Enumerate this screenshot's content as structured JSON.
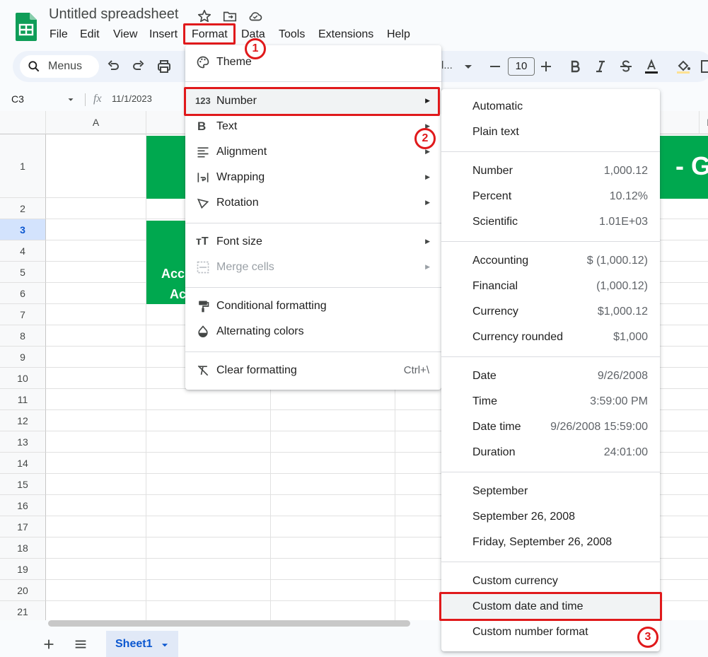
{
  "app": {
    "doc_title": "Untitled spreadsheet",
    "menu": [
      "File",
      "Edit",
      "View",
      "Insert",
      "Format",
      "Data",
      "Tools",
      "Extensions",
      "Help"
    ]
  },
  "toolbar": {
    "search_label": "Menus",
    "font_placeholder": "l...",
    "font_size": "10"
  },
  "formula_bar": {
    "cell_ref": "C3",
    "fx_label": "fx",
    "value": "11/1/2023"
  },
  "grid": {
    "columns": [
      "A",
      "",
      "",
      "",
      "F"
    ],
    "rows": [
      "1",
      "2",
      "3",
      "4",
      "5",
      "6",
      "7",
      "8",
      "9",
      "10",
      "11",
      "12",
      "13",
      "14",
      "15",
      "16",
      "17",
      "18",
      "19",
      "20",
      "21"
    ],
    "selected_row": "3",
    "visible_cell_text": [
      "- G",
      "Acc",
      "Ac"
    ]
  },
  "colors": {
    "green": "#00a84f",
    "highlight_red": "#e0191b",
    "accent_blue": "#0b57d0"
  },
  "sheets": {
    "active": "Sheet1"
  },
  "format_menu": {
    "items": [
      {
        "label": "Theme",
        "icon": "palette-icon"
      },
      {
        "label": "Number",
        "icon": "number-format-icon",
        "submenu": true
      },
      {
        "label": "Text",
        "icon": "bold-icon",
        "submenu": true
      },
      {
        "label": "Alignment",
        "icon": "align-icon",
        "submenu": true
      },
      {
        "label": "Wrapping",
        "icon": "wrap-icon",
        "submenu": true
      },
      {
        "label": "Rotation",
        "icon": "rotation-icon",
        "submenu": true
      },
      {
        "label": "Font size",
        "icon": "font-size-icon",
        "submenu": true
      },
      {
        "label": "Merge cells",
        "icon": "merge-icon",
        "submenu": true,
        "disabled": true
      },
      {
        "label": "Conditional formatting",
        "icon": "paint-roller-icon"
      },
      {
        "label": "Alternating colors",
        "icon": "drop-icon"
      },
      {
        "label": "Clear formatting",
        "icon": "clear-format-icon",
        "shortcut": "Ctrl+\\"
      }
    ]
  },
  "number_submenu": {
    "items": [
      {
        "label": "Automatic",
        "value": ""
      },
      {
        "label": "Plain text",
        "value": ""
      },
      {
        "label": "Number",
        "value": "1,000.12"
      },
      {
        "label": "Percent",
        "value": "10.12%"
      },
      {
        "label": "Scientific",
        "value": "1.01E+03"
      },
      {
        "label": "Accounting",
        "value": "$ (1,000.12)"
      },
      {
        "label": "Financial",
        "value": "(1,000.12)"
      },
      {
        "label": "Currency",
        "value": "$1,000.12"
      },
      {
        "label": "Currency rounded",
        "value": "$1,000"
      },
      {
        "label": "Date",
        "value": "9/26/2008"
      },
      {
        "label": "Time",
        "value": "3:59:00 PM"
      },
      {
        "label": "Date time",
        "value": "9/26/2008 15:59:00"
      },
      {
        "label": "Duration",
        "value": "24:01:00"
      },
      {
        "label": "September",
        "value": ""
      },
      {
        "label": "September 26, 2008",
        "value": ""
      },
      {
        "label": "Friday, September 26, 2008",
        "value": ""
      },
      {
        "label": "Custom currency",
        "value": ""
      },
      {
        "label": "Custom date and time",
        "value": ""
      },
      {
        "label": "Custom number format",
        "value": ""
      }
    ]
  },
  "annotations": [
    "1",
    "2",
    "3"
  ]
}
